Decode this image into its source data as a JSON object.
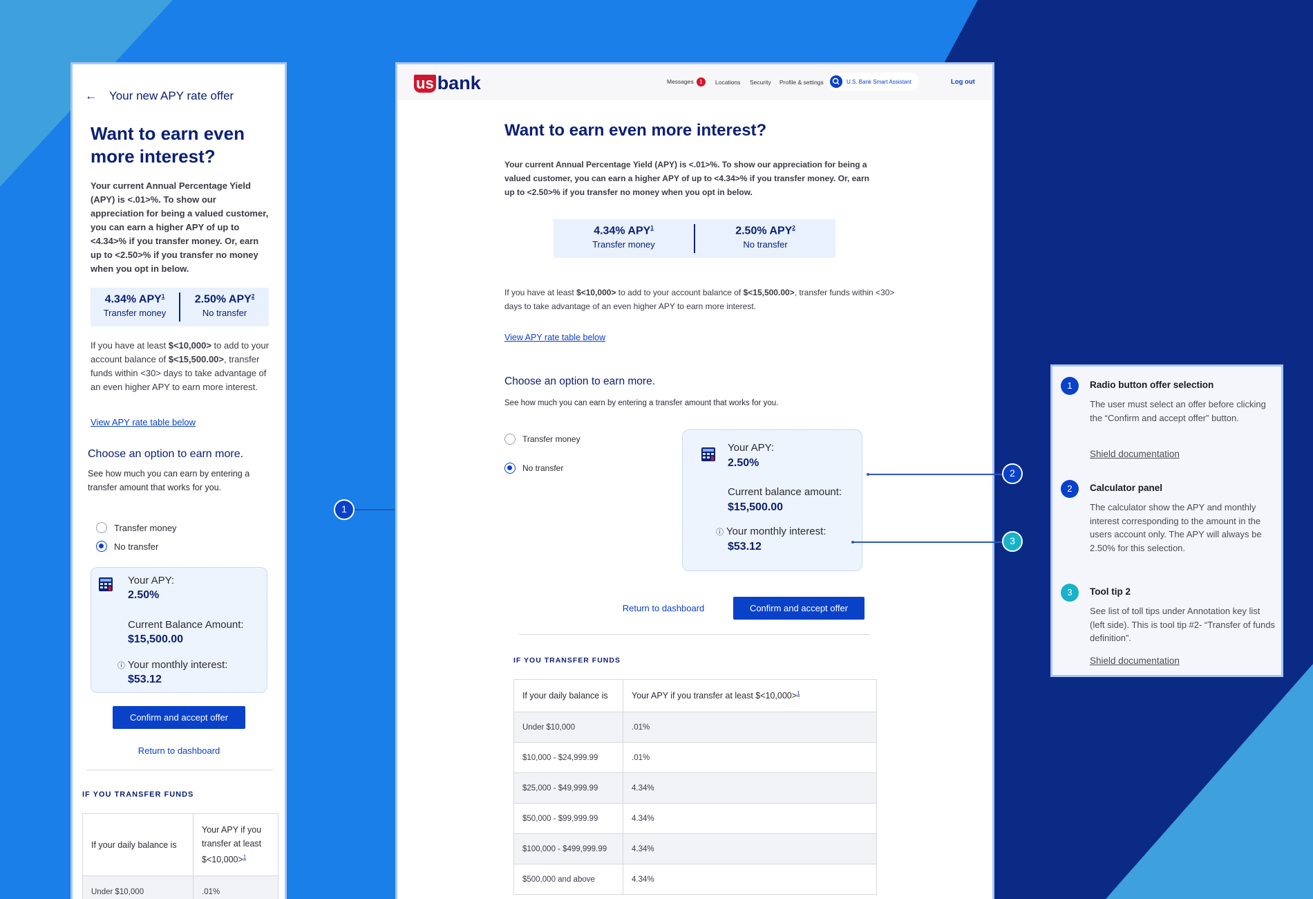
{
  "colors": {
    "brand_navy": "#0c2074",
    "primary_blue": "#0a41c9",
    "brand_red": "#d1172c",
    "teal": "#18b2c9",
    "background": "#1a7fe8"
  },
  "mobile": {
    "back_title": "Your new APY rate offer",
    "heading": "Want to earn even more interest?",
    "intro": "Your current Annual Percentage Yield (APY) is <.01>%. To show our appreciation for being a valued customer, you can earn a higher APY of up to <4.34>% if you transfer money. Or, earn up to <2.50>% if you transfer no money when you opt in below.",
    "apy": [
      {
        "value": "4.34% APY",
        "sup": "1",
        "label": "Transfer money"
      },
      {
        "value": "2.50% APY",
        "sup": "2",
        "label": "No transfer"
      }
    ],
    "balance_text_1": "If you have at least ",
    "balance_amt": "$<10,000>",
    "balance_text_2": " to add to your account balance of ",
    "balance_cur": "$<15,500.00>",
    "balance_text_3": ", transfer funds within <30> days to take advantage of an even higher APY to earn more interest.",
    "rate_link": "View APY rate table below",
    "choose_heading": "Choose an option to earn more.",
    "choose_sub": "See how much you can earn by entering a transfer amount that works for you.",
    "options": [
      "Transfer money",
      "No transfer"
    ],
    "selected_option": "No transfer",
    "calc": {
      "apy_label": "Your APY:",
      "apy_value": "2.50%",
      "balance_label": "Current Balance Amount:",
      "balance_value": "$15,500.00",
      "interest_label": "Your monthly interest:",
      "interest_value": "$53.12"
    },
    "confirm_button": "Confirm and accept offer",
    "return_link": "Return to dashboard",
    "section_caps": "IF YOU TRANSFER FUNDS",
    "table": {
      "col1": "If your daily balance is",
      "col2": "Your APY if you transfer at least $<10,000>",
      "col2_sup": "1",
      "rows": [
        [
          "Under $10,000",
          ".01%"
        ]
      ]
    }
  },
  "desktop": {
    "nav": {
      "messages": "Messages",
      "messages_count": "1",
      "locations": "Locations",
      "security": "Security",
      "profile": "Profile & settings",
      "assistant": "U.S. Bank Smart Assistant",
      "logout": "Log out"
    },
    "logo": {
      "us": "us",
      "bank": "bank"
    },
    "heading": "Want to earn even more interest?",
    "intro": "Your current Annual Percentage Yield (APY) is <.01>%. To show our appreciation for being a valued customer, you can earn a higher APY of up to <4.34>% if you transfer money. Or, earn up to <2.50>% if you transfer no money when you opt in below.",
    "apy": [
      {
        "value": "4.34% APY",
        "sup": "1",
        "label": "Transfer money"
      },
      {
        "value": "2.50% APY",
        "sup": "2",
        "label": "No transfer"
      }
    ],
    "balance_text_1": "If you have at least ",
    "balance_amt": "$<10,000>",
    "balance_text_2": " to add to your account balance of ",
    "balance_cur": "$<15,500.00>",
    "balance_text_3": ", transfer funds within <30> days to take advantage of an even higher APY to earn more interest.",
    "rate_link": "View APY rate table below",
    "choose_heading": "Choose an option to earn more.",
    "choose_sub": "See how much you can earn by entering a transfer amount that works for you.",
    "options": [
      "Transfer money",
      "No transfer"
    ],
    "selected_option": "No transfer",
    "calc": {
      "apy_label": "Your APY:",
      "apy_value": "2.50%",
      "balance_label": "Current balance amount:",
      "balance_value": "$15,500.00",
      "interest_label": "Your monthly interest:",
      "interest_value": "$53.12"
    },
    "return_link": "Return to dashboard",
    "confirm_button": "Confirm and accept offer",
    "section_caps": "IF YOU TRANSFER FUNDS",
    "table": {
      "col1": "If your daily balance is",
      "col2": "Your APY if you transfer at least $<10,000>",
      "col2_sup": "1",
      "rows": [
        [
          "Under $10,000",
          ".01%"
        ],
        [
          "$10,000 - $24,999.99",
          ".01%"
        ],
        [
          "$25,000 - $49,999.99",
          "4.34%"
        ],
        [
          "$50,000 - $99,999.99",
          "4.34%"
        ],
        [
          "$100,000 - $499,999.99",
          "4.34%"
        ],
        [
          "$500,000 and above",
          "4.34%"
        ]
      ]
    }
  },
  "markers": [
    "1",
    "2",
    "3"
  ],
  "legend": [
    {
      "num": "1",
      "title": "Radio button offer selection",
      "body": "The user must select an offer before clicking the “Confirm and accept offer” button.",
      "link": "Shield documentation"
    },
    {
      "num": "2",
      "title": "Calculator panel",
      "body": "The calculator show the APY and monthly interest corresponding to the amount in the users account only. The APY will always be 2.50% for this selection.",
      "link": ""
    },
    {
      "num": "3",
      "title": "Tool tip 2",
      "body": "See list of toll tips under Annotation key list (left side). This is tool tip #2- “Transfer of funds definition”.",
      "link": "Shield documentation"
    }
  ]
}
